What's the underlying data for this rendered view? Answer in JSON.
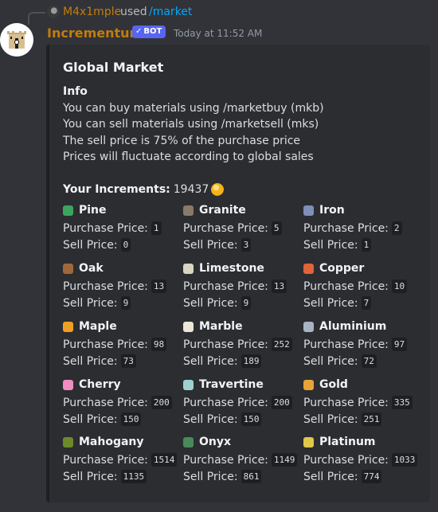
{
  "reply": {
    "username": "M4x1mple",
    "used_text": "used",
    "command": "/market"
  },
  "message": {
    "author": "Incrementum",
    "bot_badge": "BOT",
    "timestamp": "Today at 11:52 AM",
    "author_color": "#c27c0e"
  },
  "embed": {
    "title": "Global Market",
    "info_heading": "Info",
    "info_lines": [
      "You can buy materials using /marketbuy (mkb)",
      "You can sell materials using /marketsell (mks)",
      "The sell price is 75% of the purchase price",
      "Prices will fluctuate according to global sales"
    ],
    "increments_label": "Your Increments:",
    "increments_value": "19437",
    "purchase_label": "Purchase Price:",
    "sell_label": "Sell Price:",
    "items": [
      {
        "name": "Pine",
        "icon": "pine-icon",
        "color": "#3ba55c",
        "purchase": "1",
        "sell": "0"
      },
      {
        "name": "Granite",
        "icon": "granite-icon",
        "color": "#8a7a6a",
        "purchase": "5",
        "sell": "3"
      },
      {
        "name": "Iron",
        "icon": "iron-icon",
        "color": "#7e8fb8",
        "purchase": "2",
        "sell": "1"
      },
      {
        "name": "Oak",
        "icon": "oak-icon",
        "color": "#a0683a",
        "purchase": "13",
        "sell": "9"
      },
      {
        "name": "Limestone",
        "icon": "limestone-icon",
        "color": "#d9d4c3",
        "purchase": "13",
        "sell": "9"
      },
      {
        "name": "Copper",
        "icon": "copper-icon",
        "color": "#e0633a",
        "purchase": "10",
        "sell": "7"
      },
      {
        "name": "Maple",
        "icon": "maple-icon",
        "color": "#f0a020",
        "purchase": "98",
        "sell": "73"
      },
      {
        "name": "Marble",
        "icon": "marble-icon",
        "color": "#ece6d6",
        "purchase": "252",
        "sell": "189"
      },
      {
        "name": "Aluminium",
        "icon": "aluminium-icon",
        "color": "#a9b4c2",
        "purchase": "97",
        "sell": "72"
      },
      {
        "name": "Cherry",
        "icon": "cherry-icon",
        "color": "#f08cc0",
        "purchase": "200",
        "sell": "150"
      },
      {
        "name": "Travertine",
        "icon": "travertine-icon",
        "color": "#9fd0d0",
        "purchase": "200",
        "sell": "150"
      },
      {
        "name": "Gold",
        "icon": "gold-icon",
        "color": "#e8a33a",
        "purchase": "335",
        "sell": "251"
      },
      {
        "name": "Mahogany",
        "icon": "mahogany-icon",
        "color": "#6d8a2a",
        "purchase": "1514",
        "sell": "1135"
      },
      {
        "name": "Onyx",
        "icon": "onyx-icon",
        "color": "#4a8a5a",
        "purchase": "1149",
        "sell": "861"
      },
      {
        "name": "Platinum",
        "icon": "platinum-icon",
        "color": "#e0c84a",
        "purchase": "1033",
        "sell": "774"
      }
    ]
  }
}
